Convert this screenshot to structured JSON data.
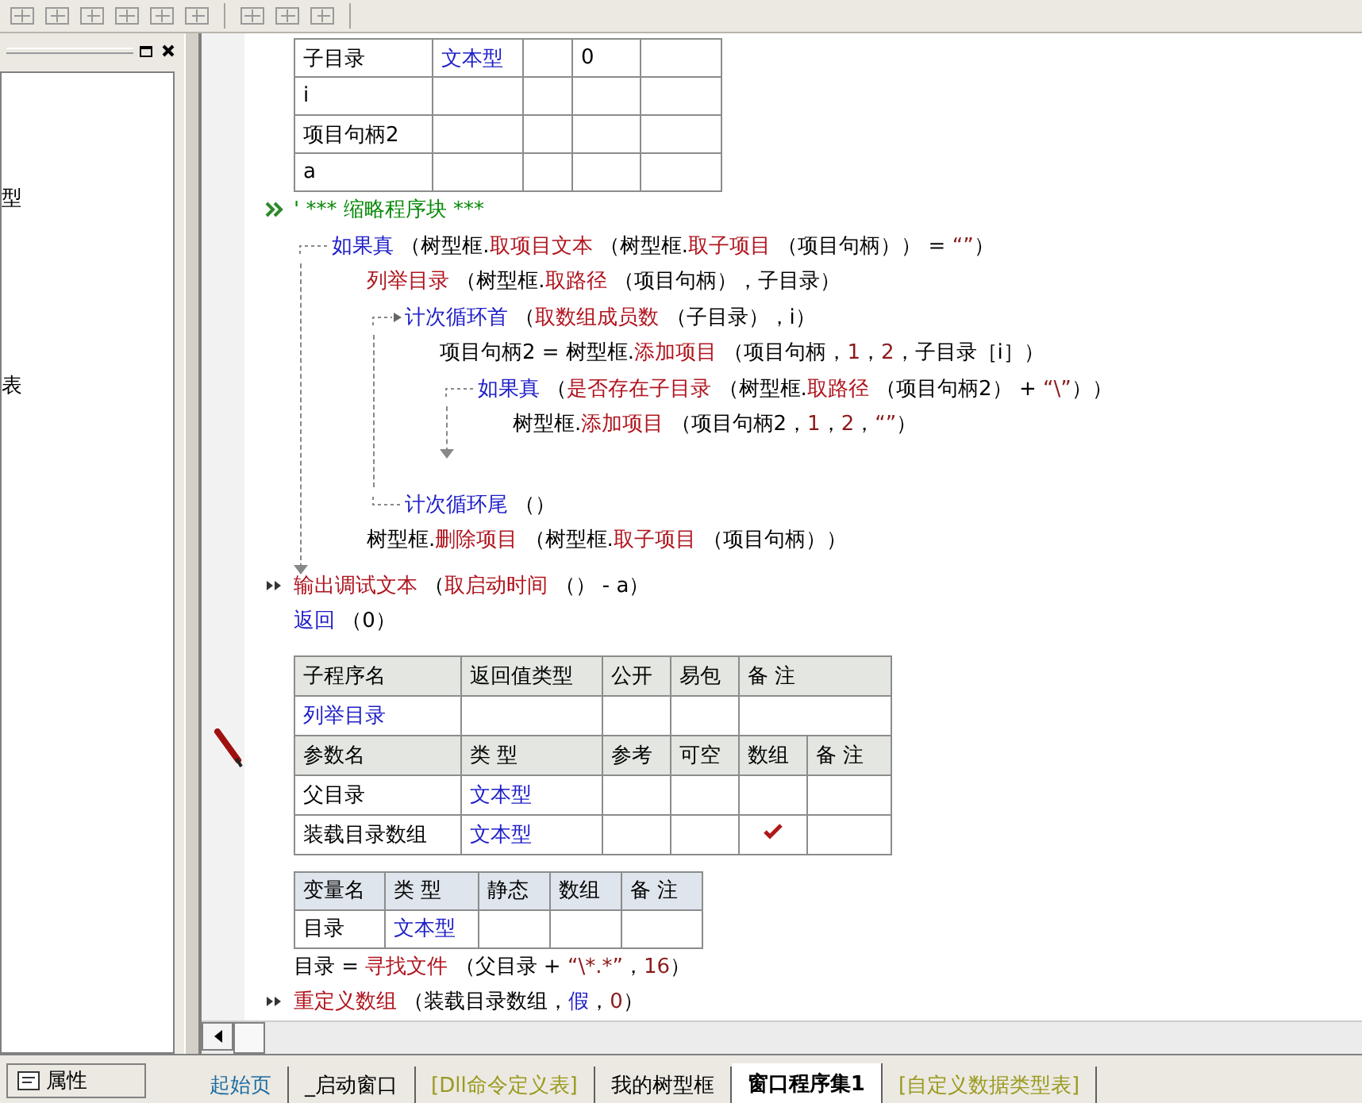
{
  "left_panel": {
    "items": [
      "型",
      "表"
    ],
    "button": "属性"
  },
  "top_table": {
    "rows": [
      [
        "子目录",
        "文本型",
        "",
        "0",
        ""
      ],
      [
        "i",
        "",
        "",
        "",
        ""
      ],
      [
        "项目句柄2",
        "",
        "",
        "",
        ""
      ],
      [
        "a",
        "",
        "",
        "",
        ""
      ]
    ]
  },
  "block1": [
    {
      "kind": "stmt",
      "marker": {
        "kind": "collapse"
      },
      "line": [
        {
          "kind": "cm",
          "text": "' *** 缩略程序块 ***"
        }
      ]
    },
    {
      "kind": "if",
      "line": [
        {
          "kind": "kw",
          "text": "如果真"
        },
        {
          "kind": "tx",
          "text": " （树型框."
        },
        {
          "kind": "fn",
          "text": "取项目文本"
        },
        {
          "kind": "tx",
          "text": " （树型框."
        },
        {
          "kind": "fn",
          "text": "取子项目"
        },
        {
          "kind": "tx",
          "text": " （项目句柄）） = "
        },
        {
          "kind": "lit",
          "text": "“”"
        },
        {
          "kind": "tx",
          "text": "）"
        }
      ],
      "children": [
        {
          "kind": "stmt",
          "line": [
            {
              "kind": "fn",
              "text": "列举目录"
            },
            {
              "kind": "tx",
              "text": " （树型框."
            },
            {
              "kind": "fn",
              "text": "取路径"
            },
            {
              "kind": "tx",
              "text": " （项目句柄），子目录）"
            }
          ]
        },
        {
          "kind": "loop",
          "line": [
            {
              "kind": "kw",
              "text": "计次循环首"
            },
            {
              "kind": "tx",
              "text": " （"
            },
            {
              "kind": "fn",
              "text": "取数组成员数"
            },
            {
              "kind": "tx",
              "text": " （子目录），i）"
            }
          ],
          "end": [
            {
              "kind": "kw",
              "text": "计次循环尾"
            },
            {
              "kind": "tx",
              "text": " （）"
            }
          ],
          "children": [
            {
              "kind": "stmt",
              "line": [
                {
                  "kind": "tx",
                  "text": "项目句柄2 = 树型框."
                },
                {
                  "kind": "fn",
                  "text": "添加项目"
                },
                {
                  "kind": "tx",
                  "text": " （项目句柄，"
                },
                {
                  "kind": "lit",
                  "text": "1"
                },
                {
                  "kind": "tx",
                  "text": "，"
                },
                {
                  "kind": "lit",
                  "text": "2"
                },
                {
                  "kind": "tx",
                  "text": "，子目录［i］）"
                }
              ]
            },
            {
              "kind": "if",
              "line": [
                {
                  "kind": "kw",
                  "text": "如果真"
                },
                {
                  "kind": "tx",
                  "text": " （"
                },
                {
                  "kind": "fn",
                  "text": "是否存在子目录"
                },
                {
                  "kind": "tx",
                  "text": " （树型框."
                },
                {
                  "kind": "fn",
                  "text": "取路径"
                },
                {
                  "kind": "tx",
                  "text": " （项目句柄2） + "
                },
                {
                  "kind": "lit",
                  "text": "“\\”"
                },
                {
                  "kind": "tx",
                  "text": "））"
                }
              ],
              "children": [
                {
                  "kind": "stmt",
                  "line": [
                    {
                      "kind": "tx",
                      "text": "树型框."
                    },
                    {
                      "kind": "fn",
                      "text": "添加项目"
                    },
                    {
                      "kind": "tx",
                      "text": " （项目句柄2，"
                    },
                    {
                      "kind": "lit",
                      "text": "1"
                    },
                    {
                      "kind": "tx",
                      "text": "，"
                    },
                    {
                      "kind": "lit",
                      "text": "2"
                    },
                    {
                      "kind": "tx",
                      "text": "，"
                    },
                    {
                      "kind": "lit",
                      "text": "“”"
                    },
                    {
                      "kind": "tx",
                      "text": "）"
                    }
                  ]
                }
              ]
            }
          ]
        },
        {
          "kind": "stmt",
          "line": [
            {
              "kind": "tx",
              "text": "树型框."
            },
            {
              "kind": "fn",
              "text": "删除项目"
            },
            {
              "kind": "tx",
              "text": " （树型框."
            },
            {
              "kind": "fn",
              "text": "取子项目"
            },
            {
              "kind": "tx",
              "text": " （项目句柄））"
            }
          ]
        }
      ]
    },
    {
      "kind": "stmt",
      "marker": {
        "kind": "step"
      },
      "line": [
        {
          "kind": "fn",
          "text": "输出调试文本"
        },
        {
          "kind": "tx",
          "text": " （"
        },
        {
          "kind": "fn",
          "text": "取启动时间"
        },
        {
          "kind": "tx",
          "text": " （） - a）"
        }
      ]
    },
    {
      "kind": "stmt",
      "line": [
        {
          "kind": "kw",
          "text": "返回"
        },
        {
          "kind": "tx",
          "text": " （0）"
        }
      ]
    }
  ],
  "sub_table": {
    "header": [
      "子程序名",
      "返回值类型",
      "公开",
      "易包",
      "备 注"
    ],
    "name": "列举目录",
    "param_header": [
      "参数名",
      "类 型",
      "参考",
      "可空",
      "数组",
      "备 注"
    ],
    "params": [
      {
        "name": "父目录",
        "type": "文本型",
        "array": false
      },
      {
        "name": "装载目录数组",
        "type": "文本型",
        "array": true
      }
    ]
  },
  "locals": {
    "header": [
      "变量名",
      "类 型",
      "静态",
      "数组",
      "备 注"
    ],
    "rows": [
      {
        "name": "目录",
        "type": "文本型"
      }
    ]
  },
  "block2": [
    {
      "kind": "stmt",
      "line": [
        {
          "kind": "tx",
          "text": "目录 = "
        },
        {
          "kind": "fn",
          "text": "寻找文件"
        },
        {
          "kind": "tx",
          "text": " （父目录 + "
        },
        {
          "kind": "lit",
          "text": "“\\*.*”"
        },
        {
          "kind": "tx",
          "text": "，"
        },
        {
          "kind": "lit",
          "text": "16"
        },
        {
          "kind": "tx",
          "text": "）"
        }
      ]
    },
    {
      "kind": "stmt",
      "marker": {
        "kind": "step"
      },
      "line": [
        {
          "kind": "fn",
          "text": "重定义数组"
        },
        {
          "kind": "tx",
          "text": " （装载目录数组，"
        },
        {
          "kind": "kw",
          "text": "假"
        },
        {
          "kind": "tx",
          "text": "，"
        },
        {
          "kind": "lit",
          "text": "0"
        },
        {
          "kind": "tx",
          "text": "）"
        }
      ]
    }
  ],
  "tabs": [
    {
      "label": "起始页",
      "kind": "page",
      "selected": false
    },
    {
      "label": "_启动窗口",
      "kind": "window",
      "selected": false
    },
    {
      "label": "[Dll命令定义表]",
      "kind": "table",
      "selected": false
    },
    {
      "label": "我的树型框",
      "kind": "window",
      "selected": false
    },
    {
      "label": "窗口程序集1",
      "kind": "window",
      "selected": true
    },
    {
      "label": "[自定义数据类型表]",
      "kind": "table",
      "selected": false
    }
  ]
}
